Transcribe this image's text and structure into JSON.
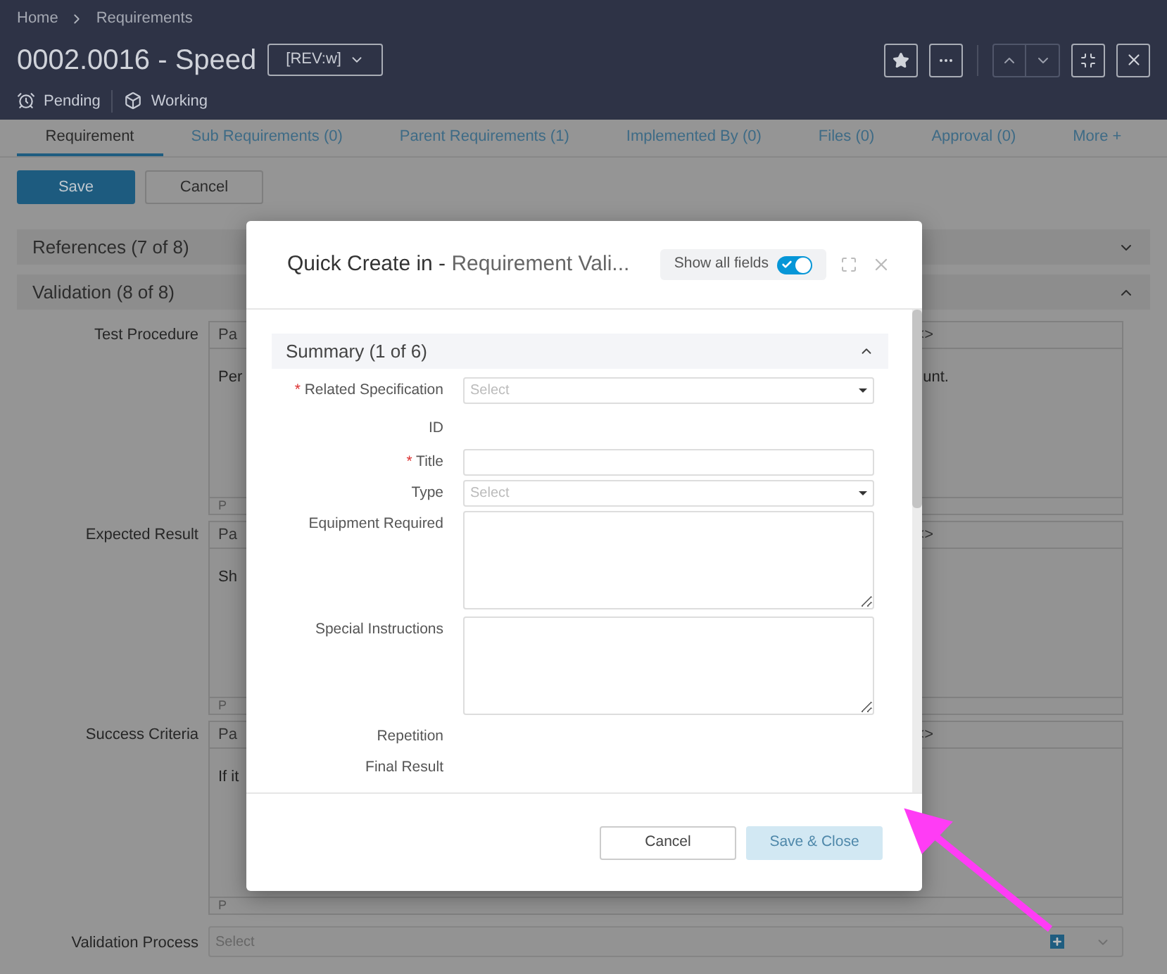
{
  "breadcrumb": [
    {
      "label": "Home"
    },
    {
      "label": "Requirements"
    }
  ],
  "header": {
    "title": "0002.0016 - Speed",
    "revision": "[REV:w]",
    "status": [
      {
        "kind": "pending",
        "label": "Pending"
      },
      {
        "kind": "working",
        "label": "Working"
      }
    ]
  },
  "tabs": [
    {
      "label": "Requirement",
      "selected": true
    },
    {
      "label": "Sub Requirements (0)",
      "selected": false
    },
    {
      "label": "Parent Requirements (1)",
      "selected": false
    },
    {
      "label": "Implemented By (0)",
      "selected": false
    },
    {
      "label": "Files (0)",
      "selected": false
    },
    {
      "label": "Approval (0)",
      "selected": false
    },
    {
      "label": "More +",
      "selected": false
    }
  ],
  "actions": [
    {
      "label": "Save",
      "kind": "primary"
    },
    {
      "label": "Cancel",
      "kind": "secondary"
    }
  ],
  "sections": [
    {
      "title": "References (7 of 8)",
      "expanded": false
    },
    {
      "title": "Validation (8 of 8)",
      "expanded": true
    }
  ],
  "fields": [
    {
      "kind": "editor",
      "label": "Test Procedure",
      "toolbar_left": "Pa",
      "toolbar_right": "<>",
      "text_left": "Per",
      "text_right": "unt.",
      "footer": "P"
    },
    {
      "kind": "editor",
      "label": "Expected Result",
      "toolbar_left": "Pa",
      "toolbar_right": "<>",
      "text_left": "Sh",
      "footer": "P"
    },
    {
      "kind": "editor",
      "label": "Success Criteria",
      "toolbar_left": "Pa",
      "toolbar_right": "<>",
      "text_left": "If it",
      "footer": "P"
    },
    {
      "kind": "select",
      "label": "Validation Process",
      "placeholder": "Select"
    }
  ],
  "modal": {
    "required_mark": "*",
    "title": "Quick Create in - ",
    "subtitle": "Requirement Vali...",
    "toggle": {
      "label": "Show all fields",
      "on": true
    },
    "section": {
      "title": "Summary (1 of 6)",
      "expanded": true
    },
    "fields": [
      {
        "kind": "select",
        "label": "Related Specification",
        "required": true,
        "placeholder": "Select"
      },
      {
        "kind": "readonly",
        "label": "ID",
        "required": false
      },
      {
        "kind": "text",
        "label": "Title",
        "required": true
      },
      {
        "kind": "select",
        "label": "Type",
        "required": false,
        "placeholder": "Select"
      },
      {
        "kind": "textarea",
        "label": "Equipment Required",
        "required": false
      },
      {
        "kind": "textarea",
        "label": "Special Instructions",
        "required": false
      },
      {
        "kind": "readonly",
        "label": "Repetition",
        "required": false
      },
      {
        "kind": "readonly",
        "label": "Final Result",
        "required": false
      }
    ],
    "buttons": [
      {
        "label": "Cancel",
        "disabled": false
      },
      {
        "label": "Save & Close",
        "disabled": true
      }
    ]
  }
}
